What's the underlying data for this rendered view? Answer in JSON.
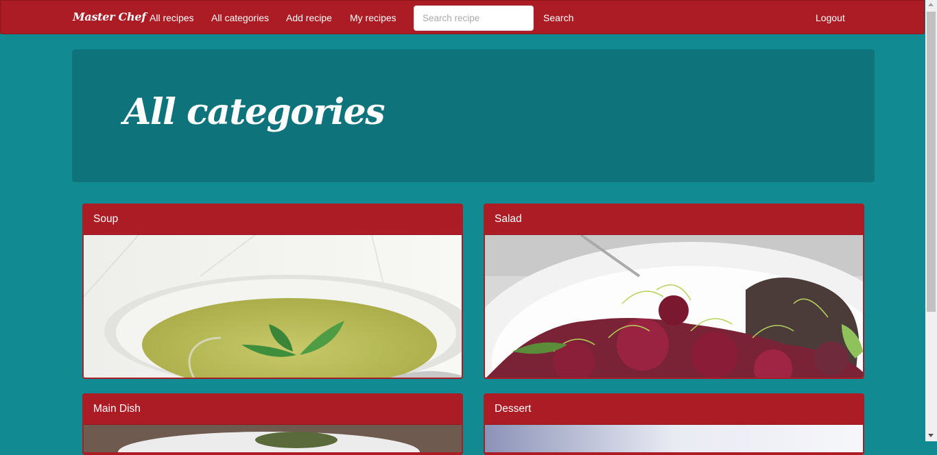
{
  "nav": {
    "brand": "Master Chef",
    "links": [
      "All recipes",
      "All categories",
      "Add recipe",
      "My recipes"
    ],
    "search_placeholder": "Search recipe",
    "search_value": "",
    "search_button": "Search",
    "logout": "Logout"
  },
  "page": {
    "title": "All categories"
  },
  "categories": [
    {
      "name": "Soup"
    },
    {
      "name": "Salad"
    },
    {
      "name": "Main Dish"
    },
    {
      "name": "Dessert"
    }
  ],
  "colors": {
    "navbar": "#ab1c25",
    "background": "#128a91",
    "jumbotron": "#0e737a",
    "card_header": "#ab1c25"
  }
}
